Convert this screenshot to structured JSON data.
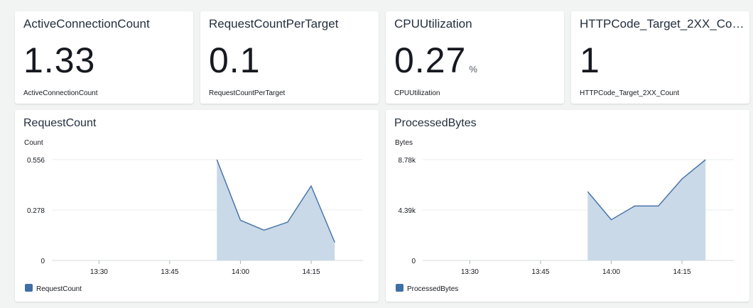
{
  "stats": [
    {
      "title": "ActiveConnectionCount",
      "value": "1.33",
      "unit": "",
      "label": "ActiveConnectionCount"
    },
    {
      "title": "RequestCountPerTarget",
      "value": "0.1",
      "unit": "",
      "label": "RequestCountPerTarget"
    },
    {
      "title": "CPUUtilization",
      "value": "0.27",
      "unit": "%",
      "label": "CPUUtilization"
    },
    {
      "title": "HTTPCode_Target_2XX_Co…",
      "value": "1",
      "unit": "",
      "label": "HTTPCode_Target_2XX_Count"
    }
  ],
  "colors": {
    "line": "#4a76a8",
    "fill": "#c9d9e8",
    "legend": "#3f6fa5",
    "grid": "#eaeded"
  },
  "chart_data": [
    {
      "type": "area",
      "title": "RequestCount",
      "ylabel": "Count",
      "xlabel": "",
      "x_tick_labels": [
        "13:30",
        "13:45",
        "14:00",
        "14:15"
      ],
      "y_tick_labels": [
        "0.556",
        "0.278",
        "0"
      ],
      "ylim": [
        0,
        0.556
      ],
      "grid": true,
      "legend_position": "bottom-left",
      "series": [
        {
          "name": "RequestCount",
          "x": [
            "13:55",
            "14:00",
            "14:05",
            "14:10",
            "14:15",
            "14:20"
          ],
          "values": [
            0.556,
            0.222,
            0.167,
            0.211,
            0.411,
            0.1
          ]
        }
      ]
    },
    {
      "type": "area",
      "title": "ProcessedBytes",
      "ylabel": "Bytes",
      "xlabel": "",
      "x_tick_labels": [
        "13:30",
        "13:45",
        "14:00",
        "14:15"
      ],
      "y_tick_labels": [
        "8.78k",
        "4.39k",
        "0"
      ],
      "ylim": [
        0,
        8780
      ],
      "grid": true,
      "legend_position": "bottom-left",
      "series": [
        {
          "name": "ProcessedBytes",
          "x": [
            "13:55",
            "14:00",
            "14:05",
            "14:10",
            "14:15",
            "14:20"
          ],
          "values": [
            6000,
            3550,
            4750,
            4750,
            7100,
            8780
          ]
        }
      ]
    }
  ]
}
